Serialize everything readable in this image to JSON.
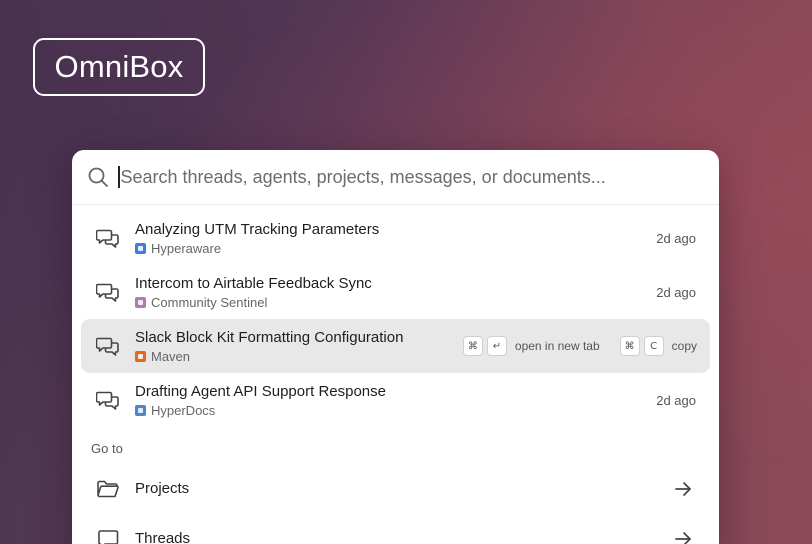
{
  "brand": {
    "logo_text": "OmniBox"
  },
  "search": {
    "placeholder": "Search threads, agents, projects, messages, or documents..."
  },
  "results": [
    {
      "title": "Analyzing UTM Tracking Parameters",
      "source": "Hyperaware",
      "source_color": "#3d7fd9",
      "time": "2d ago",
      "icon": "chat-bubbles-icon",
      "selected": false
    },
    {
      "title": "Intercom to Airtable Feedback Sync",
      "source": "Community Sentinel",
      "source_color": "#b07bb0",
      "time": "2d ago",
      "icon": "chat-bubbles-icon",
      "selected": false
    },
    {
      "title": "Slack Block Kit Formatting Configuration",
      "source": "Maven",
      "source_color": "#e06a1f",
      "time": "",
      "icon": "chat-bubbles-icon",
      "selected": true
    },
    {
      "title": "Drafting Agent API Support Response",
      "source": "HyperDocs",
      "source_color": "#4a86c8",
      "time": "2d ago",
      "icon": "chat-bubbles-icon",
      "selected": false
    }
  ],
  "shortcuts": {
    "open_keys": [
      "⌘",
      "↵"
    ],
    "open_label": "open in new tab",
    "copy_keys": [
      "⌘",
      "C"
    ],
    "copy_label": "copy"
  },
  "goto": {
    "label": "Go to",
    "items": [
      {
        "label": "Projects",
        "icon": "folder-icon"
      },
      {
        "label": "Threads",
        "icon": "chat-bubble-icon"
      }
    ]
  }
}
